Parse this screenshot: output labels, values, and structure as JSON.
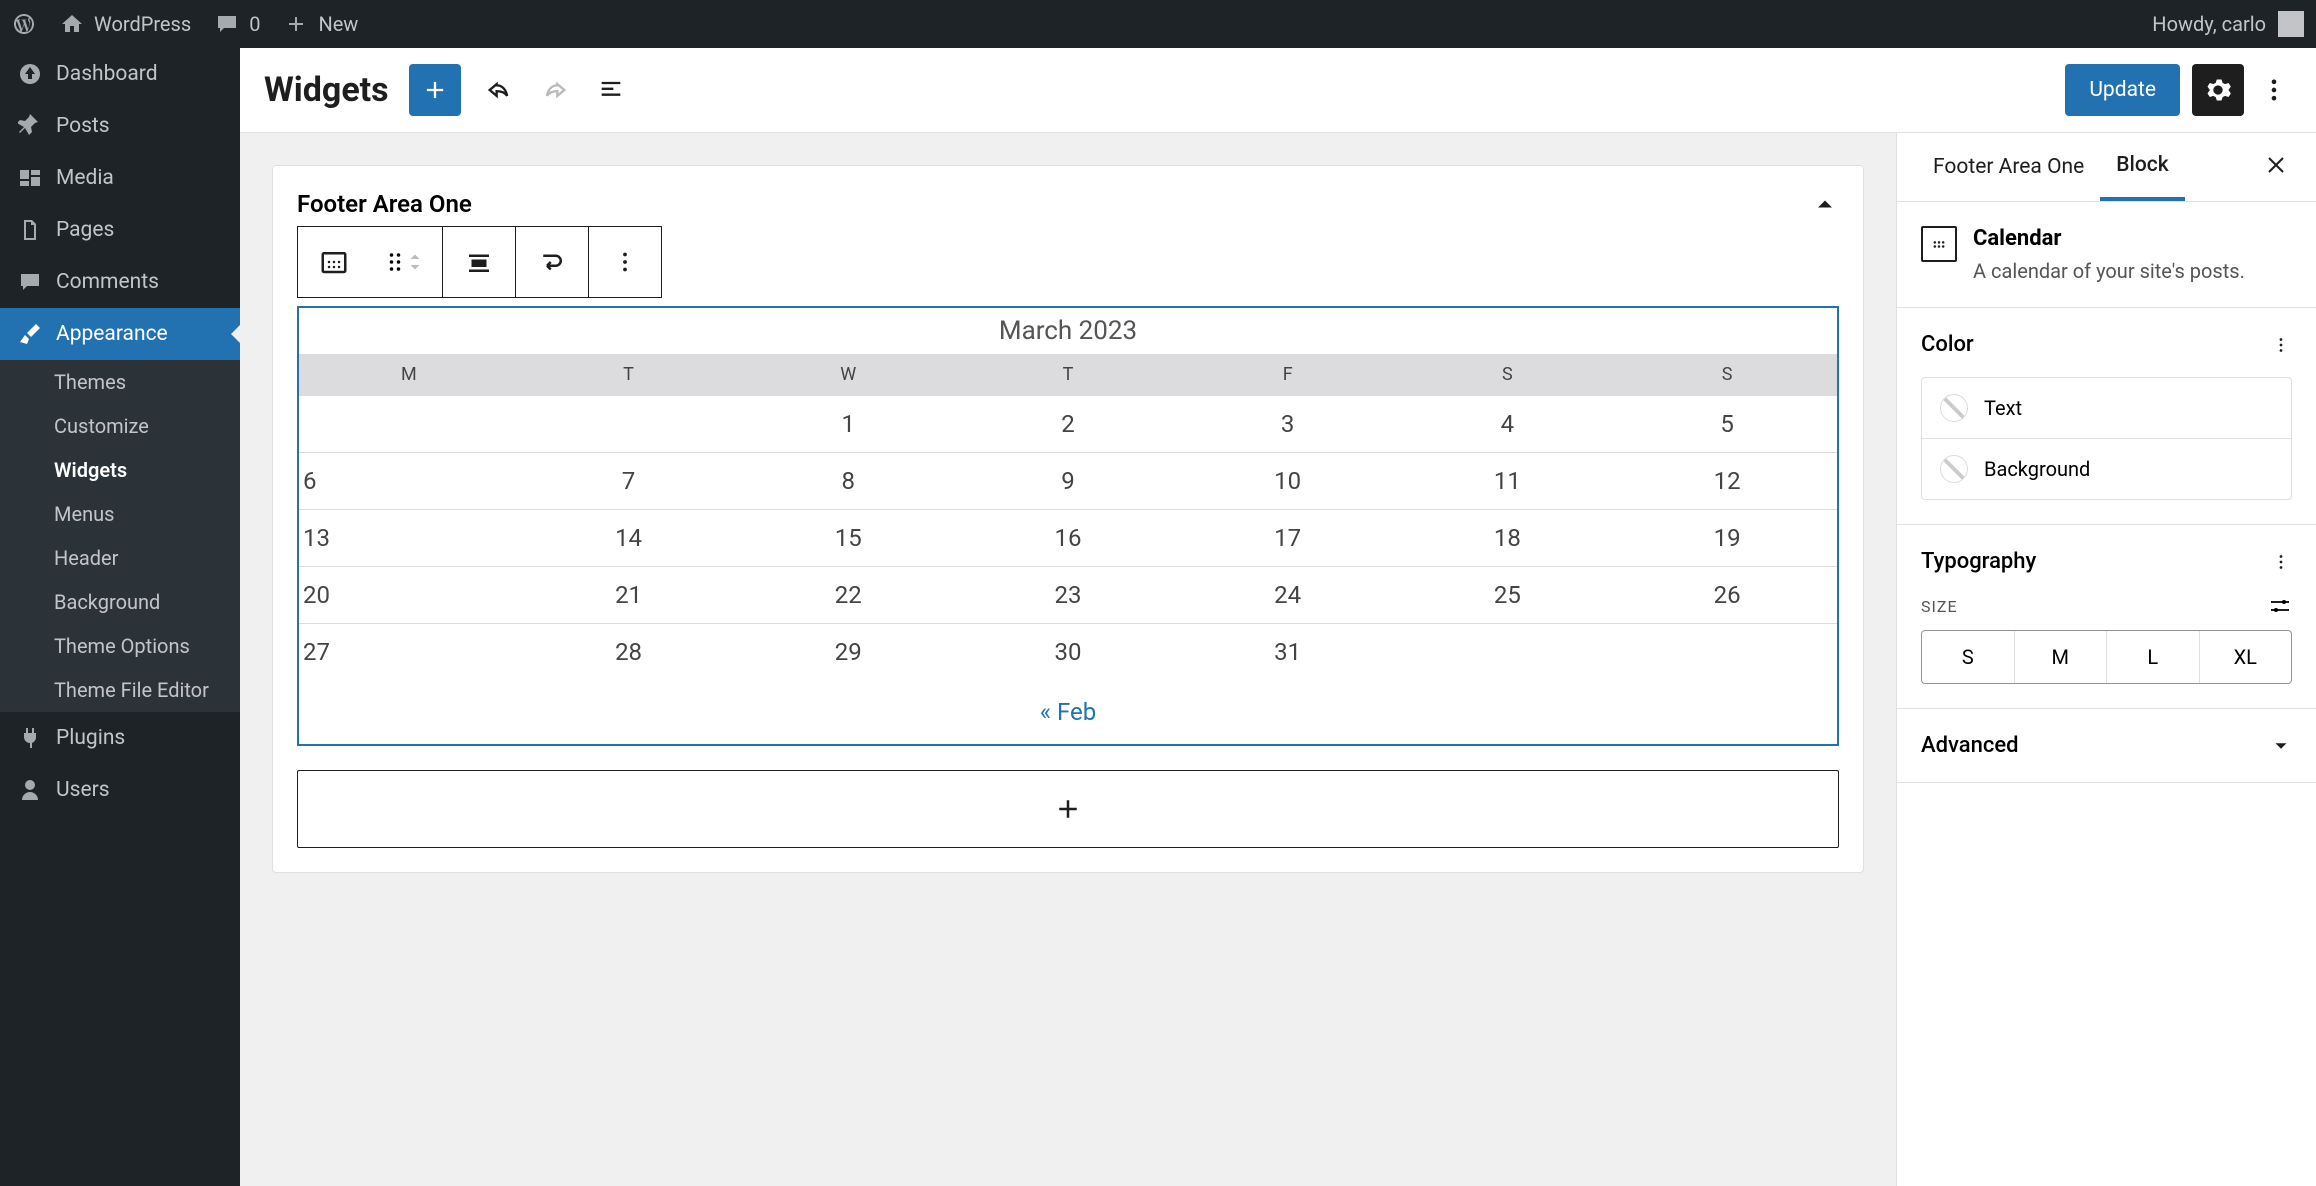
{
  "adminBar": {
    "siteName": "WordPress",
    "commentsCount": "0",
    "newLabel": "New",
    "greeting": "Howdy, carlo"
  },
  "sideMenu": {
    "items": [
      {
        "label": "Dashboard",
        "icon": "dashboard"
      },
      {
        "label": "Posts",
        "icon": "pin"
      },
      {
        "label": "Media",
        "icon": "media"
      },
      {
        "label": "Pages",
        "icon": "pages"
      },
      {
        "label": "Comments",
        "icon": "comment"
      },
      {
        "label": "Appearance",
        "icon": "brush",
        "current": true
      },
      {
        "label": "Plugins",
        "icon": "plug"
      },
      {
        "label": "Users",
        "icon": "user"
      }
    ],
    "submenu": [
      {
        "label": "Themes"
      },
      {
        "label": "Customize"
      },
      {
        "label": "Widgets",
        "current": true
      },
      {
        "label": "Menus"
      },
      {
        "label": "Header"
      },
      {
        "label": "Background"
      },
      {
        "label": "Theme Options"
      },
      {
        "label": "Theme File Editor"
      }
    ]
  },
  "header": {
    "title": "Widgets",
    "updateLabel": "Update"
  },
  "widgetArea": {
    "title": "Footer Area One"
  },
  "calendar": {
    "caption": "March 2023",
    "dayHeaders": [
      "M",
      "T",
      "W",
      "T",
      "F",
      "S",
      "S"
    ],
    "weeks": [
      [
        "",
        "",
        "1",
        "2",
        "3",
        "4",
        "5"
      ],
      [
        "6",
        "7",
        "8",
        "9",
        "10",
        "11",
        "12"
      ],
      [
        "13",
        "14",
        "15",
        "16",
        "17",
        "18",
        "19"
      ],
      [
        "20",
        "21",
        "22",
        "23",
        "24",
        "25",
        "26"
      ],
      [
        "27",
        "28",
        "29",
        "30",
        "31",
        "",
        ""
      ]
    ],
    "prevLink": "« Feb"
  },
  "inspector": {
    "tab1": "Footer Area One",
    "tab2": "Block",
    "blockName": "Calendar",
    "blockDesc": "A calendar of your site's posts.",
    "colorLabel": "Color",
    "colorText": "Text",
    "colorBg": "Background",
    "typographyLabel": "Typography",
    "sizeLabel": "SIZE",
    "sizes": [
      "S",
      "M",
      "L",
      "XL"
    ],
    "advancedLabel": "Advanced"
  }
}
